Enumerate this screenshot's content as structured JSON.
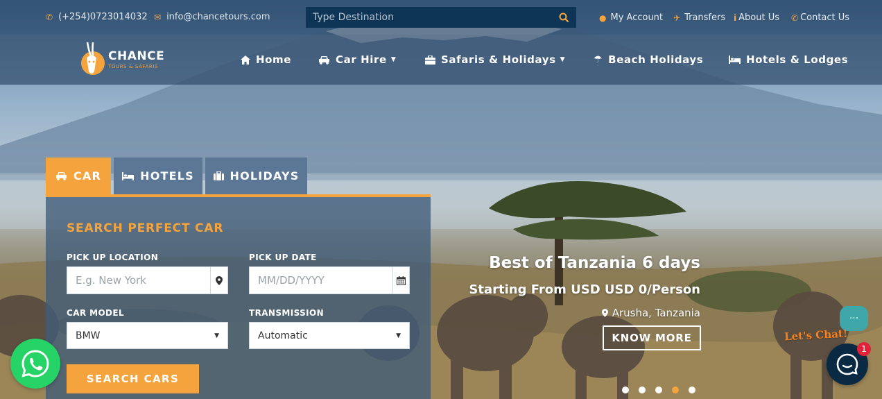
{
  "topbar": {
    "phone": "(+254)0723014032",
    "email": "info@chancetours.com",
    "search_placeholder": "Type Destination",
    "links": [
      {
        "label": "My Account",
        "icon": "user-icon"
      },
      {
        "label": "Transfers",
        "icon": "plane-icon"
      },
      {
        "label": "About Us",
        "icon": "info-icon"
      },
      {
        "label": "Contact Us",
        "icon": "phone-icon"
      }
    ]
  },
  "logo": {
    "name": "CHANCE",
    "tagline": "TOURS & SAFARIS"
  },
  "nav": {
    "items": [
      {
        "label": "Home",
        "icon": "home-icon",
        "dropdown": false
      },
      {
        "label": "Car Hire",
        "icon": "car-icon",
        "dropdown": true
      },
      {
        "label": "Safaris & Holidays",
        "icon": "briefcase-icon",
        "dropdown": true
      },
      {
        "label": "Beach Holidays",
        "icon": "umbrella-icon",
        "dropdown": false
      },
      {
        "label": "Hotels & Lodges",
        "icon": "bed-icon",
        "dropdown": false
      }
    ]
  },
  "search_panel": {
    "tabs": [
      {
        "label": "CAR",
        "icon": "car-icon",
        "active": true
      },
      {
        "label": "HOTELS",
        "icon": "bed-icon",
        "active": false
      },
      {
        "label": "HOLIDAYS",
        "icon": "suitcase-icon",
        "active": false
      }
    ],
    "title": "SEARCH PERFECT CAR",
    "pickup_location_label": "PICK UP LOCATION",
    "pickup_location_placeholder": "E.g. New York",
    "pickup_date_label": "PICK UP DATE",
    "pickup_date_placeholder": "MM/DD/YYYY",
    "car_model_label": "CAR MODEL",
    "car_model_value": "BMW",
    "transmission_label": "TRANSMISSION",
    "transmission_value": "Automatic",
    "submit_label": "SEARCH CARS"
  },
  "hero": {
    "title": "Best of Tanzania 6 days",
    "subtitle": "Starting From USD USD 0/Person",
    "location": "Arusha, Tanzania",
    "cta_label": "KNOW MORE",
    "slide_count": 5,
    "active_slide": 4
  },
  "widgets": {
    "chat_label": "Let's Chat!",
    "chat_badge_count": "1",
    "chat_bubble_text": "···"
  },
  "colors": {
    "accent": "#f5a33c",
    "topbar": "#1c3a5c",
    "search_bg": "#0f3556",
    "whatsapp": "#25d366",
    "chat_launcher": "#0a2a44",
    "badge": "#e0223a"
  }
}
